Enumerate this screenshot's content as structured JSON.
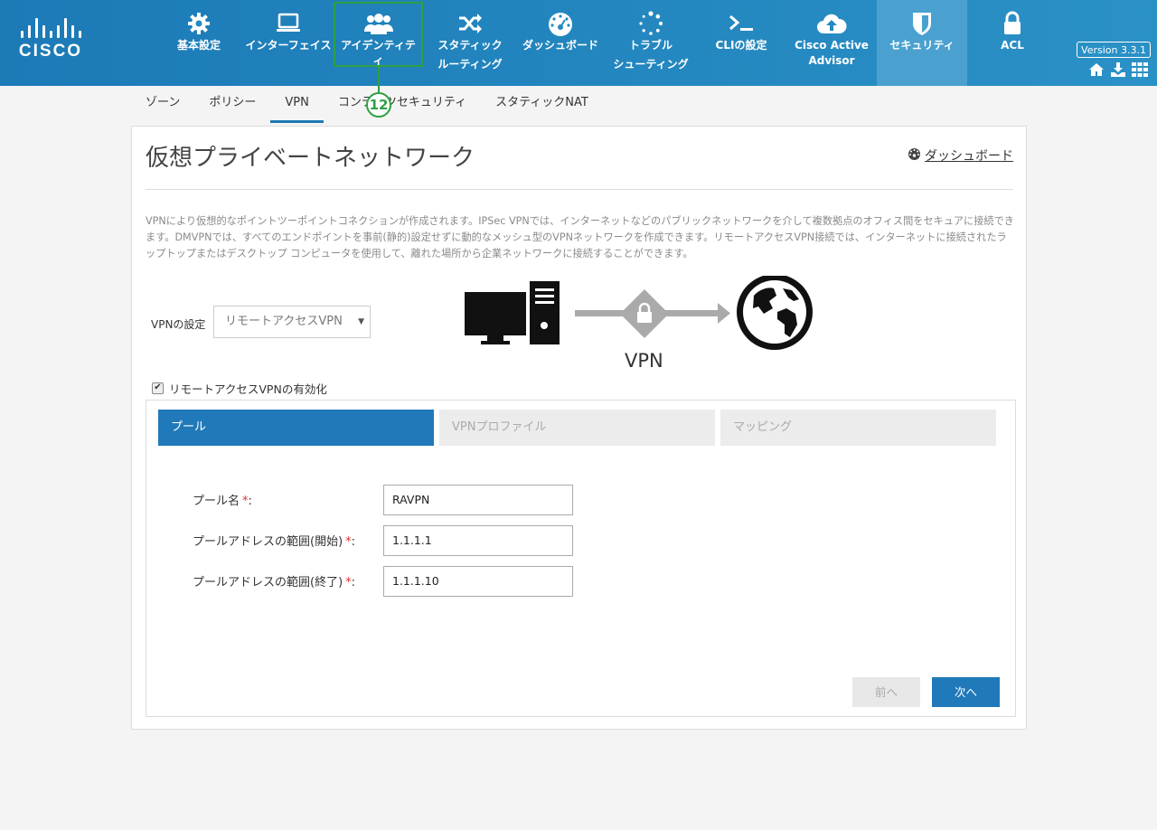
{
  "brand": {
    "logo_text": "CISCO"
  },
  "nav": {
    "items": [
      {
        "label": "基本設定",
        "label2": "",
        "icon": "gear-icon"
      },
      {
        "label": "インターフェイス",
        "label2": "",
        "icon": "monitor-icon"
      },
      {
        "label": "アイデンティティ",
        "label2": "",
        "icon": "users-icon"
      },
      {
        "label": "スタティック",
        "label2": "ルーティング",
        "icon": "shuffle-icon"
      },
      {
        "label": "ダッシュボード",
        "label2": "",
        "icon": "gauge-icon"
      },
      {
        "label": "トラブル",
        "label2": "シューティング",
        "icon": "spinner-icon"
      },
      {
        "label": "CLIの設定",
        "label2": "",
        "icon": "terminal-icon"
      },
      {
        "label": "Cisco Active",
        "label2": "Advisor",
        "icon": "cloud-upload-icon"
      },
      {
        "label": "セキュリティ",
        "label2": "",
        "icon": "shield-icon"
      },
      {
        "label": "ACL",
        "label2": "",
        "icon": "lock-icon"
      }
    ],
    "active_index": 8,
    "version": "Version 3.3.1",
    "callout_number": "12"
  },
  "subtabs": {
    "items": [
      "ゾーン",
      "ポリシー",
      "VPN",
      "コンテンツセキュリティ",
      "スタティックNAT"
    ],
    "active_index": 2
  },
  "page": {
    "title": "仮想プライベートネットワーク",
    "dashboard_link": "ダッシュボード",
    "description": "VPNにより仮想的なポイントツーポイントコネクションが作成されます。IPSec VPNでは、インターネットなどのパブリックネットワークを介して複数拠点のオフィス間をセキュアに接続できます。DMVPNでは、すべてのエンドポイントを事前(静的)設定せずに動的なメッシュ型のVPNネットワークを作成できます。リモートアクセスVPN接続では、インターネットに接続されたラップトップまたはデスクトップ コンピュータを使用して、離れた場所から企業ネットワークに接続することができます。",
    "vpn_setting_label": "VPNの設定",
    "vpn_setting_value": "リモートアクセスVPN",
    "diagram_label": "VPN",
    "enable_label": "リモートアクセスVPNの有効化",
    "enable_checked": true
  },
  "wizard": {
    "tabs": [
      "プール",
      "VPNプロファイル",
      "マッピング"
    ],
    "active_index": 0,
    "fields": [
      {
        "label": "プール名",
        "required_mark": "*",
        "suffix": ":",
        "value": "RAVPN"
      },
      {
        "label": "プールアドレスの範囲(開始)",
        "required_mark": "*",
        "suffix": ":",
        "value": "1.1.1.1"
      },
      {
        "label": "プールアドレスの範囲(終了)",
        "required_mark": "*",
        "suffix": ":",
        "value": "1.1.1.10"
      }
    ],
    "prev_label": "前へ",
    "next_label": "次へ"
  }
}
